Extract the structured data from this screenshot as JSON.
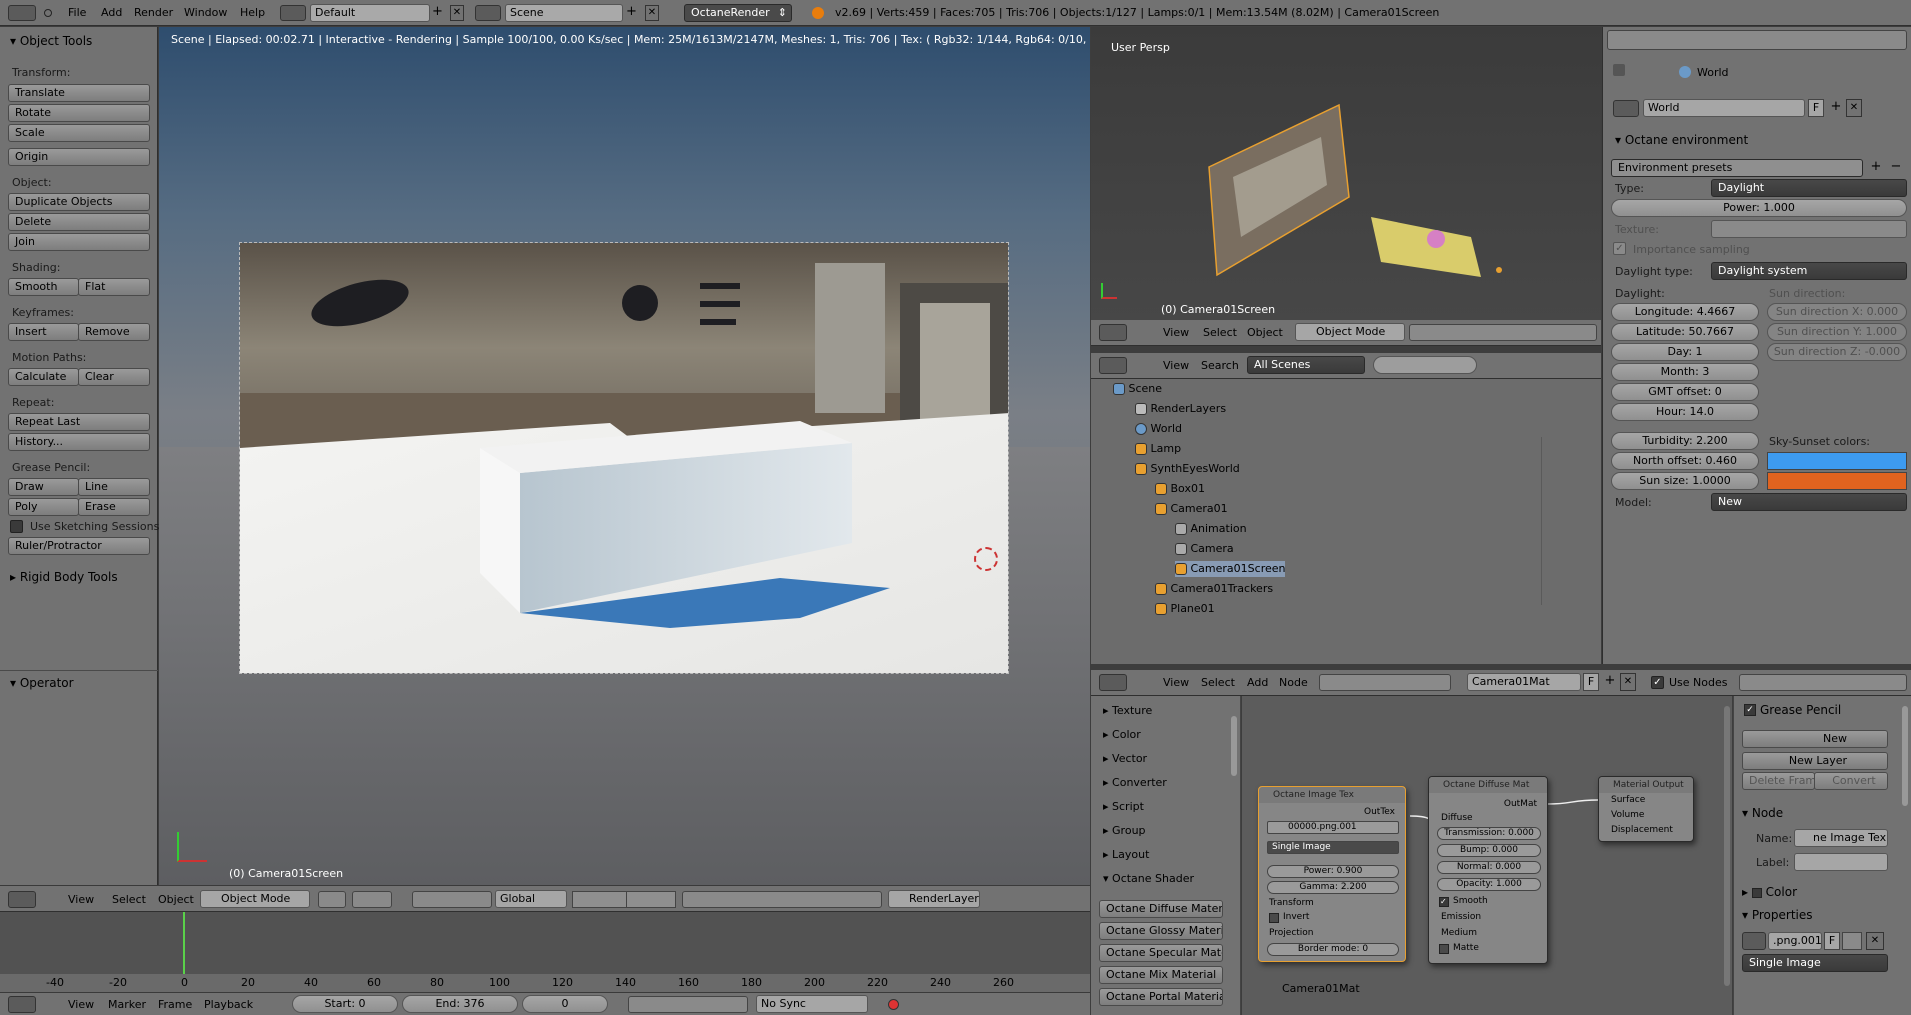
{
  "topbar": {
    "menus": [
      "File",
      "Add",
      "Render",
      "Window",
      "Help"
    ],
    "layout": "Default",
    "scene": "Scene",
    "engine": "OctaneRender",
    "stats": "v2.69 | Verts:459 | Faces:705 | Tris:706 | Objects:1/127 | Lamps:0/1 | Mem:13.54M (8.02M) | Camera01Screen"
  },
  "tools": {
    "title": "Object Tools",
    "transform_h": "Transform:",
    "translate": "Translate",
    "rotate": "Rotate",
    "scale": "Scale",
    "origin": "Origin",
    "object_h": "Object:",
    "duplicate": "Duplicate Objects",
    "delete": "Delete",
    "join": "Join",
    "shading_h": "Shading:",
    "smooth": "Smooth",
    "flat": "Flat",
    "keyframes_h": "Keyframes:",
    "insert": "Insert",
    "remove": "Remove",
    "motion_h": "Motion Paths:",
    "calculate": "Calculate",
    "clear": "Clear",
    "repeat_h": "Repeat:",
    "repeat_last": "Repeat Last",
    "history": "History...",
    "grease_h": "Grease Pencil:",
    "draw": "Draw",
    "line": "Line",
    "poly": "Poly",
    "erase": "Erase",
    "sketching": "Use Sketching Sessions",
    "ruler": "Ruler/Protractor",
    "rigid": "Rigid Body Tools",
    "operator": "Operator"
  },
  "viewport": {
    "status": "Scene | Elapsed: 00:02.71 | Interactive - Rendering | Sample 100/100, 0.00 Ks/sec | Mem: 25M/1613M/2147M, Meshes: 1, Tris: 706 | Tex: ( Rgb32: 1/144, Rgb64: 0/10, grey8: 0/68, gr",
    "object_label": "(0) Camera01Screen",
    "header": {
      "view": "View",
      "select": "Select",
      "object": "Object",
      "mode": "Object Mode",
      "orient": "Global",
      "renderlayer": "RenderLayer"
    }
  },
  "persp": {
    "title": "User Persp",
    "object_label": "(0) Camera01Screen",
    "header": {
      "view": "View",
      "select": "Select",
      "object": "Object",
      "mode": "Object Mode"
    }
  },
  "outliner": {
    "header": {
      "view": "View",
      "search": "Search",
      "filter": "All Scenes"
    },
    "items": [
      {
        "name": "Scene",
        "indent": 0
      },
      {
        "name": "RenderLayers",
        "indent": 1
      },
      {
        "name": "World",
        "indent": 1
      },
      {
        "name": "Lamp",
        "indent": 1
      },
      {
        "name": "SynthEyesWorld",
        "indent": 1
      },
      {
        "name": "Box01",
        "indent": 2
      },
      {
        "name": "Camera01",
        "indent": 2
      },
      {
        "name": "Animation",
        "indent": 3
      },
      {
        "name": "Camera",
        "indent": 3
      },
      {
        "name": "Camera01Screen",
        "indent": 3
      },
      {
        "name": "Camera01Trackers",
        "indent": 2
      },
      {
        "name": "Plane01",
        "indent": 2
      }
    ]
  },
  "props": {
    "world": "World",
    "world_field": "World",
    "section": "Octane environment",
    "presets": "Environment presets",
    "type_label": "Type:",
    "type_value": "Daylight",
    "power": "Power: 1.000",
    "texture_label": "Texture:",
    "importance": "Importance sampling",
    "daylight_type_label": "Daylight type:",
    "daylight_type_value": "Daylight system",
    "daylight_h": "Daylight:",
    "sun_dir_h": "Sun direction:",
    "longitude": "Longitude: 4.4667",
    "latitude": "Latitude: 50.7667",
    "day": "Day: 1",
    "month": "Month: 3",
    "gmt": "GMT offset: 0",
    "hour": "Hour: 14.0",
    "sunx": "Sun direction X: 0.000",
    "suny": "Sun direction Y: 1.000",
    "sunz": "Sun direction Z: -0.000",
    "turbidity": "Turbidity: 2.200",
    "north": "North offset: 0.460",
    "sunsize": "Sun size: 1.0000",
    "sky_colors": "Sky-Sunset colors:",
    "model_label": "Model:",
    "model_value": "New",
    "sky_color1": "#3d9bf0",
    "sky_color2": "#e0631f"
  },
  "nodeeditor": {
    "header": {
      "view": "View",
      "select": "Select",
      "add": "Add",
      "node": "Node",
      "material": "Camera01Mat",
      "use_nodes": "Use Nodes"
    },
    "categories": [
      "Texture",
      "Color",
      "Vector",
      "Converter",
      "Script",
      "Group",
      "Layout",
      "Octane Shader"
    ],
    "shaders": [
      "Octane Diffuse Material",
      "Octane Glossy Material",
      "Octane Specular Materi",
      "Octane Mix Material",
      "Octane Portal Material"
    ],
    "mat_label": "Camera01Mat",
    "imgtex": {
      "title": "Octane Image Tex",
      "out": "OutTex",
      "file": "00000.png.001",
      "mode": "Single Image",
      "power": "Power: 0.900",
      "gamma": "Gamma: 2.200",
      "transform": "Transform",
      "invert": "Invert",
      "projection": "Projection",
      "border": "Border mode: 0"
    },
    "diffuse": {
      "title": "Octane Diffuse Mat",
      "out": "OutMat",
      "diffuse": "Diffuse",
      "transmission": "Transmission: 0.000",
      "bump": "Bump: 0.000",
      "normal": "Normal: 0.000",
      "opacity": "Opacity: 1.000",
      "smooth": "Smooth",
      "emission": "Emission",
      "medium": "Medium",
      "matte": "Matte"
    },
    "output": {
      "title": "Material Output",
      "surface": "Surface",
      "volume": "Volume",
      "displacement": "Displacement"
    }
  },
  "nodeprops": {
    "grease": "Grease Pencil",
    "new": "New",
    "new_layer": "New Layer",
    "delete_frame": "Delete Frame",
    "convert": "Convert",
    "node_h": "Node",
    "name_label": "Name:",
    "name_value": "ne Image Tex",
    "label_label": "Label:",
    "color": "Color",
    "properties": "Properties",
    "file": ".png.001",
    "mode": "Single Image"
  },
  "timeline": {
    "ticks": [
      "-40",
      "-20",
      "0",
      "20",
      "40",
      "60",
      "80",
      "100",
      "120",
      "140",
      "160",
      "180",
      "200",
      "220",
      "240",
      "260"
    ],
    "menus": [
      "View",
      "Marker",
      "Frame",
      "Playback"
    ],
    "start": "Start: 0",
    "end": "End: 376",
    "current": "0",
    "sync": "No Sync"
  }
}
